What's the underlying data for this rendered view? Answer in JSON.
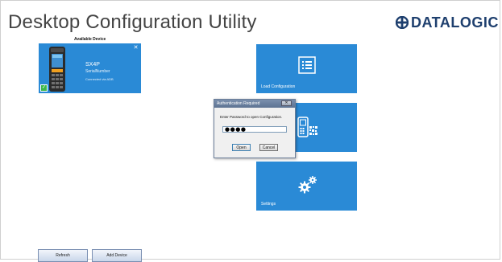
{
  "app": {
    "title": "Desktop Configuration Utility",
    "brand": "DATALOGIC"
  },
  "device_panel": {
    "heading": "Available Device",
    "device": {
      "model": "SX4P",
      "serial": "SerialNumber",
      "connection": "Connected via ADB",
      "selected": true
    },
    "close_icon": "close-icon"
  },
  "tiles": [
    {
      "label": "Load Configuration",
      "icon": "list-document-icon"
    },
    {
      "label": "",
      "icon": "device-barcode-icon"
    },
    {
      "label": "Settings",
      "icon": "gears-icon"
    }
  ],
  "buttons": {
    "refresh": "Refresh",
    "add_device": "Add Device"
  },
  "dialog": {
    "title": "Authentication Required",
    "close_label": "✕",
    "prompt": "Enter Password to open Configuration.",
    "password_masked": "●●●●",
    "open_label": "Open",
    "cancel_label": "Cancel"
  },
  "colors": {
    "tile_blue": "#2a8ad6",
    "brand_navy": "#1e3f6e",
    "check_green": "#3db84b"
  }
}
